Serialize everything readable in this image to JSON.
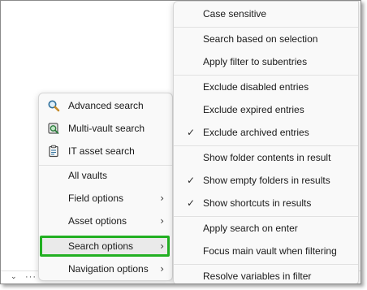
{
  "left_menu": {
    "items": [
      {
        "label": "Advanced search",
        "icon": "magnifier-search-icon"
      },
      {
        "label": "Multi-vault search",
        "icon": "vault-search-icon"
      },
      {
        "label": "IT asset search",
        "icon": "clipboard-asset-icon"
      },
      {
        "label": "All vaults"
      },
      {
        "label": "Field options",
        "submenu": true
      },
      {
        "label": "Asset options",
        "submenu": true
      },
      {
        "label": "Search options",
        "submenu": true,
        "highlighted": true
      },
      {
        "label": "Navigation options",
        "submenu": true
      }
    ],
    "highlight_color": "#22b022"
  },
  "right_menu": {
    "items": [
      {
        "label": "Case sensitive",
        "checked": false
      },
      {
        "label": "Search based on selection",
        "checked": false
      },
      {
        "label": "Apply filter to subentries",
        "checked": false
      },
      {
        "label": "Exclude disabled entries",
        "checked": false
      },
      {
        "label": "Exclude expired entries",
        "checked": false
      },
      {
        "label": "Exclude archived entries",
        "checked": true
      },
      {
        "label": "Show folder contents in result",
        "checked": false
      },
      {
        "label": "Show empty folders in results",
        "checked": true
      },
      {
        "label": "Show shortcuts in results",
        "checked": true
      },
      {
        "label": "Apply search on enter",
        "checked": false
      },
      {
        "label": "Focus main vault when filtering",
        "checked": false
      },
      {
        "label": "Resolve variables in filter",
        "checked": false
      }
    ]
  },
  "symbols": {
    "check": "✓",
    "submenu_arrow": "›",
    "chevron": "⌄",
    "more": "···"
  }
}
